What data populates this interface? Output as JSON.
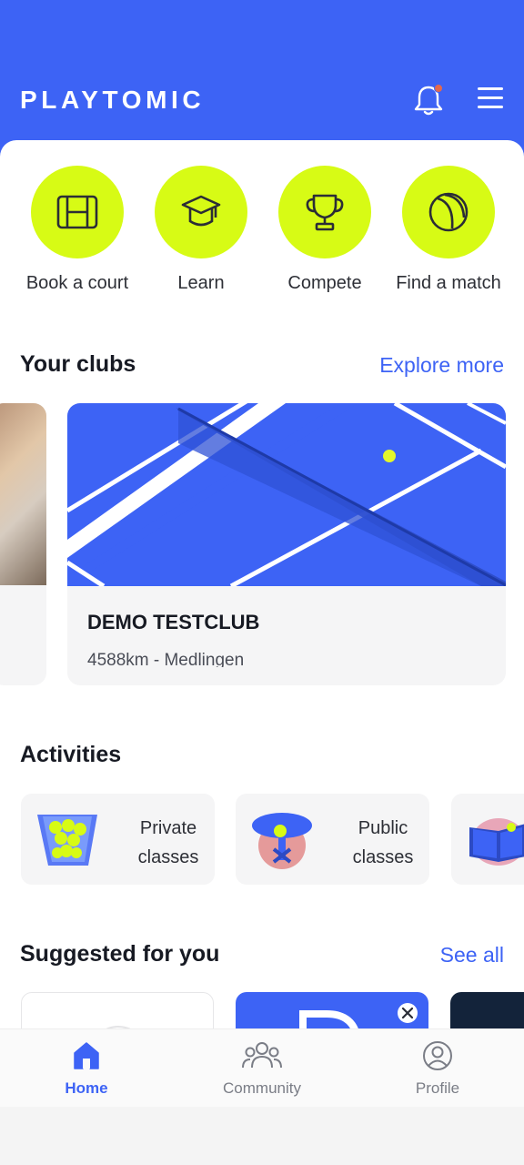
{
  "app": {
    "name": "PLAYTOMIC"
  },
  "colors": {
    "brand_blue": "#3d63f5",
    "accent_lime": "#d7fb15",
    "notification_dot": "#e3684e"
  },
  "quick_actions": [
    {
      "label": "Book a court",
      "icon": "court-icon"
    },
    {
      "label": "Learn",
      "icon": "graduation-cap-icon"
    },
    {
      "label": "Compete",
      "icon": "trophy-icon"
    },
    {
      "label": "Find a match",
      "icon": "ball-icon"
    }
  ],
  "clubs": {
    "title": "Your clubs",
    "link": "Explore more",
    "card": {
      "name": "DEMO TESTCLUB",
      "distance": "4588km - Medlingen"
    }
  },
  "activities": {
    "title": "Activities",
    "items": [
      {
        "line1": "Private",
        "line2": "classes"
      },
      {
        "line1": "Public",
        "line2": "classes"
      }
    ]
  },
  "suggested": {
    "title": "Suggested for you",
    "link": "See all"
  },
  "nav": {
    "home": "Home",
    "community": "Community",
    "profile": "Profile"
  }
}
